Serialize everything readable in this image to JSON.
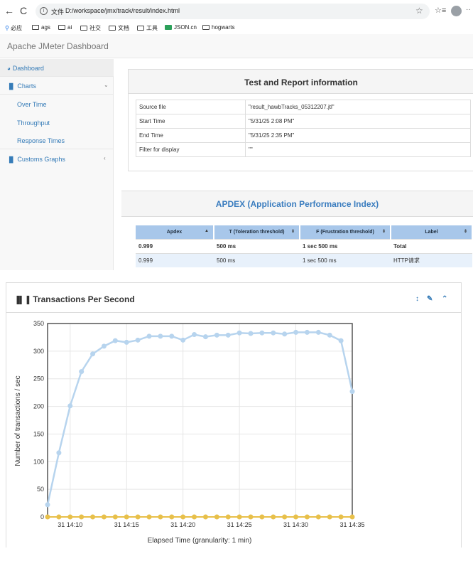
{
  "browser": {
    "back": "←",
    "refresh": "C",
    "info_icon": "i",
    "protocol_label": "文件",
    "url": "D:/workspace/jmx/track/result/index.html",
    "bookmarks": [
      {
        "label": "必应",
        "icon": "search-icon"
      },
      {
        "label": "ags",
        "icon": "folder-icon"
      },
      {
        "label": "ai",
        "icon": "folder-icon"
      },
      {
        "label": "社交",
        "icon": "folder-icon"
      },
      {
        "label": "文档",
        "icon": "folder-icon"
      },
      {
        "label": "工具",
        "icon": "folder-icon"
      },
      {
        "label": "JSON.cn",
        "icon": "json-icon"
      },
      {
        "label": "hogwarts",
        "icon": "folder-icon"
      }
    ]
  },
  "app": {
    "brand": "Apache JMeter Dashboard"
  },
  "sidebar": {
    "items": [
      {
        "label": "Dashboard",
        "icon": "dashboard-icon"
      },
      {
        "label": "Charts",
        "icon": "bar-chart-icon"
      },
      {
        "label": "Over Time"
      },
      {
        "label": "Throughput"
      },
      {
        "label": "Response Times"
      },
      {
        "label": "Customs Graphs",
        "icon": "bar-chart-icon"
      }
    ]
  },
  "test_report": {
    "title": "Test and Report information",
    "rows": [
      {
        "key": "Source file",
        "value": "\"result_hawbTracks_05312207.jtl\""
      },
      {
        "key": "Start Time",
        "value": "\"5/31/25 2:08 PM\""
      },
      {
        "key": "End Time",
        "value": "\"5/31/25 2:35 PM\""
      },
      {
        "key": "Filter for display",
        "value": "\"\""
      }
    ]
  },
  "apdex": {
    "title": "APDEX (Application Performance Index)",
    "headers": [
      "Apdex",
      "T (Toleration threshold)",
      "F (Frustration threshold)",
      "Label"
    ],
    "rows": [
      [
        "0.999",
        "500 ms",
        "1 sec 500 ms",
        "Total"
      ],
      [
        "0.999",
        "500 ms",
        "1 sec 500 ms",
        "HTTP请求"
      ]
    ]
  },
  "chart_panel": {
    "title": "Transactions Per Second",
    "icons": [
      "resize-icon",
      "wrench-icon",
      "collapse-icon"
    ]
  },
  "chart_data": {
    "type": "line",
    "xlabel": "Elapsed Time (granularity: 1 min)",
    "ylabel": "Number of transactions / sec",
    "ylim": [
      0,
      350
    ],
    "yticks": [
      0,
      50,
      100,
      150,
      200,
      250,
      300,
      350
    ],
    "xticks": [
      {
        "label": "31 14:10",
        "t": 10
      },
      {
        "label": "31 14:15",
        "t": 15
      },
      {
        "label": "31 14:20",
        "t": 20
      },
      {
        "label": "31 14:25",
        "t": 25
      },
      {
        "label": "31 14:30",
        "t": 30
      },
      {
        "label": "31 14:35",
        "t": 35
      }
    ],
    "xlim": [
      8,
      35
    ],
    "grid": true,
    "colors": {
      "success": "#b7d4ee",
      "failure": "#e8c04a"
    },
    "series": [
      {
        "x": [
          8,
          9,
          10,
          11,
          12,
          13,
          14,
          15,
          16,
          17,
          18,
          19,
          20,
          21,
          22,
          23,
          24,
          25,
          26,
          27,
          28,
          29,
          30,
          31,
          32,
          33,
          34,
          35
        ],
        "values": [
          22,
          116,
          201,
          263,
          295,
          309,
          319,
          316,
          320,
          327,
          327,
          327,
          320,
          330,
          326,
          329,
          329,
          333,
          332,
          333,
          333,
          331,
          334,
          334,
          334,
          329,
          319,
          227
        ]
      },
      {
        "x": [
          8,
          9,
          10,
          11,
          12,
          13,
          14,
          15,
          16,
          17,
          18,
          19,
          20,
          21,
          22,
          23,
          24,
          25,
          26,
          27,
          28,
          29,
          30,
          31,
          32,
          33,
          34,
          35
        ],
        "values": [
          0,
          0,
          0,
          0,
          0,
          0,
          0,
          0,
          0,
          0,
          0,
          0,
          0,
          0,
          0,
          0,
          0,
          0,
          0,
          0,
          0,
          0,
          0,
          0,
          0,
          0,
          0,
          0
        ]
      }
    ]
  }
}
